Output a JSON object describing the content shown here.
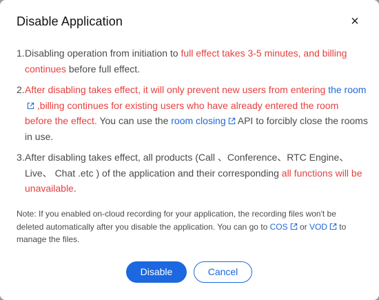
{
  "dialog": {
    "title": "Disable Application",
    "close_glyph": "×"
  },
  "items": [
    {
      "num": "1.",
      "t1": "Disabling operation from initiation to ",
      "r1": "full effect takes 3-5 minutes, and billing continues",
      "t2": " before full effect."
    },
    {
      "num": "2.",
      "r1": "After disabling takes effect, it will only prevent new users from entering ",
      "link1": "the room",
      "r2": " ,billing continues for existing users who have already entered the room before the effect.",
      "t1": " You can use the ",
      "link2": "room closing",
      "t2": " API to forcibly close the rooms in use."
    },
    {
      "num": "3.",
      "t1": "After disabling takes effect, all products (Call 、Conference、RTC Engine、Live、 Chat .etc ) of the application and their corresponding ",
      "r1": "all functions will be unavailable",
      "t2": "."
    }
  ],
  "note": {
    "t1": "Note: If you enabled on-cloud recording for your application, the recording files won't be deleted automatically after you disable the application. You can go to ",
    "link1": "COS",
    "t2": " or ",
    "link2": "VOD",
    "t3": " to manage the files."
  },
  "buttons": {
    "disable": "Disable",
    "cancel": "Cancel"
  },
  "colors": {
    "accent": "#1b68e0",
    "warning": "#e5403f",
    "link": "#1f68d8"
  },
  "icons": {
    "external_link": "external-link-icon",
    "close": "close-icon"
  }
}
